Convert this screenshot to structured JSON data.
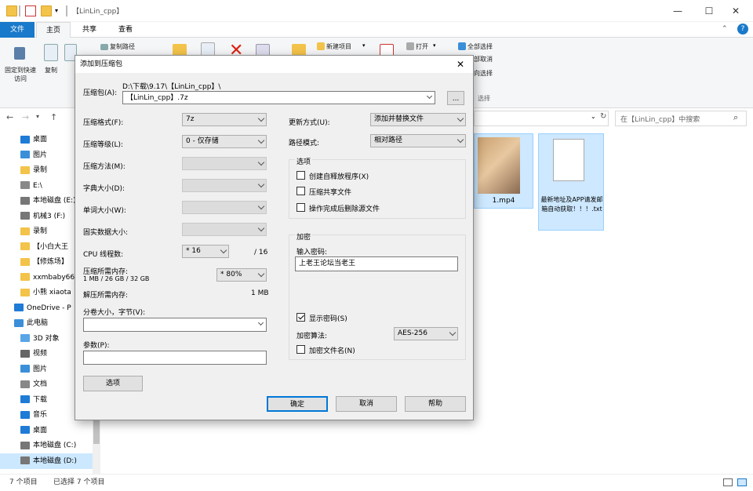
{
  "window": {
    "title": "【LinLin_cpp】",
    "min": "—",
    "max": "☐",
    "close": "✕"
  },
  "tabs": [
    "文件",
    "主页",
    "共享",
    "查看"
  ],
  "ribbon": {
    "pin_label": "固定到快速访问",
    "copy_label": "复制",
    "copy_path_label": "复制路径",
    "new_item_label": "新建项目",
    "open_label": "打开",
    "select_all_label": "全部选择",
    "select_none_label": "全部取消",
    "invert_label": "反向选择",
    "select_group_label": "选择"
  },
  "address": {
    "search_placeholder": "在【LinLin_cpp】中搜索"
  },
  "nav": [
    {
      "label": "桌面",
      "icon": "desktop-icon",
      "color": "#1e7bd6"
    },
    {
      "label": "图片",
      "icon": "pictures-icon",
      "color": "#3b8fd9"
    },
    {
      "label": "录制",
      "icon": "folder-icon",
      "color": "#f3c34a"
    },
    {
      "label": "E:\\",
      "icon": "drive-icon",
      "color": "#888888"
    },
    {
      "label": "本地磁盘 (E:)",
      "icon": "drive-icon",
      "color": "#777777"
    },
    {
      "label": "机械3 (F:)",
      "icon": "drive-icon",
      "color": "#777777"
    },
    {
      "label": "录制",
      "icon": "pin-folder-icon",
      "color": "#f3c34a"
    },
    {
      "label": "【小白大王",
      "icon": "folder-icon",
      "color": "#f3c34a"
    },
    {
      "label": "【修炼场】",
      "icon": "folder-icon",
      "color": "#f3c34a"
    },
    {
      "label": "xxmbaby66",
      "icon": "folder-icon",
      "color": "#f3c34a"
    },
    {
      "label": "小熊 xiaota",
      "icon": "folder-icon",
      "color": "#f3c34a"
    },
    {
      "label": "OneDrive - P",
      "icon": "onedrive-icon",
      "color": "#1e7bd6"
    },
    {
      "label": "此电脑",
      "icon": "pc-icon",
      "color": "#3b8fd9"
    },
    {
      "label": "3D 对象",
      "icon": "3d-icon",
      "color": "#5aa5e6"
    },
    {
      "label": "视频",
      "icon": "video-icon",
      "color": "#666666"
    },
    {
      "label": "图片",
      "icon": "pictures-icon",
      "color": "#3b8fd9"
    },
    {
      "label": "文档",
      "icon": "document-icon",
      "color": "#888888"
    },
    {
      "label": "下载",
      "icon": "download-icon",
      "color": "#1e7bd6"
    },
    {
      "label": "音乐",
      "icon": "music-icon",
      "color": "#1e7bd6"
    },
    {
      "label": "桌面",
      "icon": "desktop-icon",
      "color": "#1e7bd6"
    },
    {
      "label": "本地磁盘 (C:)",
      "icon": "drive-icon",
      "color": "#777777"
    },
    {
      "label": "本地磁盘 (D:)",
      "icon": "drive-icon",
      "color": "#777777"
    }
  ],
  "files": [
    {
      "name": "1.mp4"
    },
    {
      "name": "最新地址及APP请发邮箱自动获取！！！.txt"
    }
  ],
  "status": {
    "count": "7 个项目",
    "selected": "已选择 7 个项目"
  },
  "dialog": {
    "title": "添加到压缩包",
    "archive_label": "压缩包(A):",
    "archive_dir": "D:\\下载\\9.17\\【LinLin_cpp】\\",
    "archive_name": "【LinLin_cpp】.7z",
    "browse": "...",
    "format_label": "压缩格式(F):",
    "format_value": "7z",
    "level_label": "压缩等级(L):",
    "level_value": "0 - 仅存储",
    "method_label": "压缩方法(M):",
    "dict_label": "字典大小(D):",
    "word_label": "单词大小(W):",
    "solid_label": "固实数据大小:",
    "cpu_label": "CPU 线程数:",
    "cpu_value": "* 16",
    "cpu_max": "/ 16",
    "mem_comp_label": "压缩所需内存:",
    "mem_comp_info": "1 MB / 26 GB / 32 GB",
    "mem_comp_value": "* 80%",
    "mem_decomp_label": "解压所需内存:",
    "mem_decomp_value": "1 MB",
    "split_label": "分卷大小，字节(V):",
    "params_label": "参数(P):",
    "options_btn": "选项",
    "update_label": "更新方式(U):",
    "update_value": "添加并替换文件",
    "path_label": "路径模式:",
    "path_value": "相对路径",
    "options_group": "选项",
    "opt_sfx": "创建自释放程序(X)",
    "opt_shared": "压缩共享文件",
    "opt_delete": "操作完成后删除源文件",
    "enc_group": "加密",
    "pw_label": "输入密码:",
    "pw_value": "上老王论坛当老王",
    "show_pw": "显示密码(S)",
    "enc_method_label": "加密算法:",
    "enc_method_value": "AES-256",
    "enc_names": "加密文件名(N)",
    "ok": "确定",
    "cancel": "取消",
    "help": "帮助",
    "close": "✕"
  }
}
